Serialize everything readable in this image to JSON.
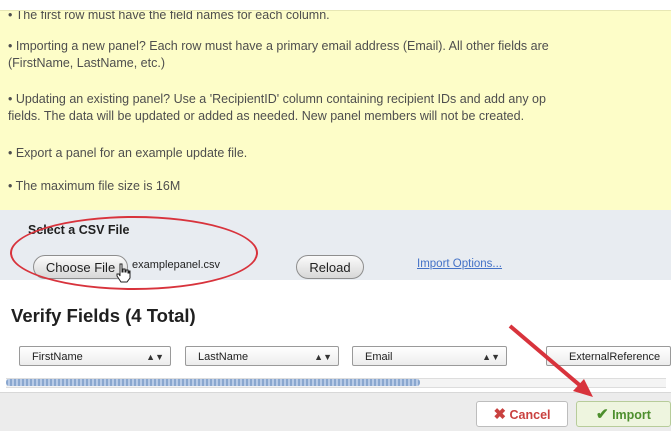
{
  "instructions": {
    "line1": "• The first row must have the field names for each column.",
    "line2a": "• Importing a new panel? Each row must have a primary email address (Email). All other fields are",
    "line2b": "(FirstName, LastName, etc.)",
    "line3a": "• Updating an existing panel? Use a 'RecipientID' column containing recipient IDs and add any op",
    "line3b": "fields. The data will be updated or added as needed. New panel members will not be created.",
    "line4": "• Export a panel for an example update file.",
    "line5": "• The maximum file size is 16M"
  },
  "select_csv": {
    "title": "Select a CSV File",
    "choose_file_label": "Choose File",
    "filename": "examplepanel.csv",
    "reload_label": "Reload",
    "import_options_link": "Import Options..."
  },
  "verify": {
    "title": "Verify Fields (4 Total)",
    "fields": [
      "FirstName",
      "LastName",
      "Email",
      "ExternalReference"
    ]
  },
  "footer": {
    "cancel_label": "Cancel",
    "import_label": "Import"
  },
  "colors": {
    "instructions_bg": "#fdfdc8",
    "annotation_red": "#d8333c",
    "cancel_red": "#c9413f",
    "import_green": "#4d8f2e",
    "link_blue": "#4472c7"
  },
  "icons": {
    "cancel": "x-icon",
    "import": "check-icon",
    "select_arrows": "up-down-arrows-icon"
  }
}
